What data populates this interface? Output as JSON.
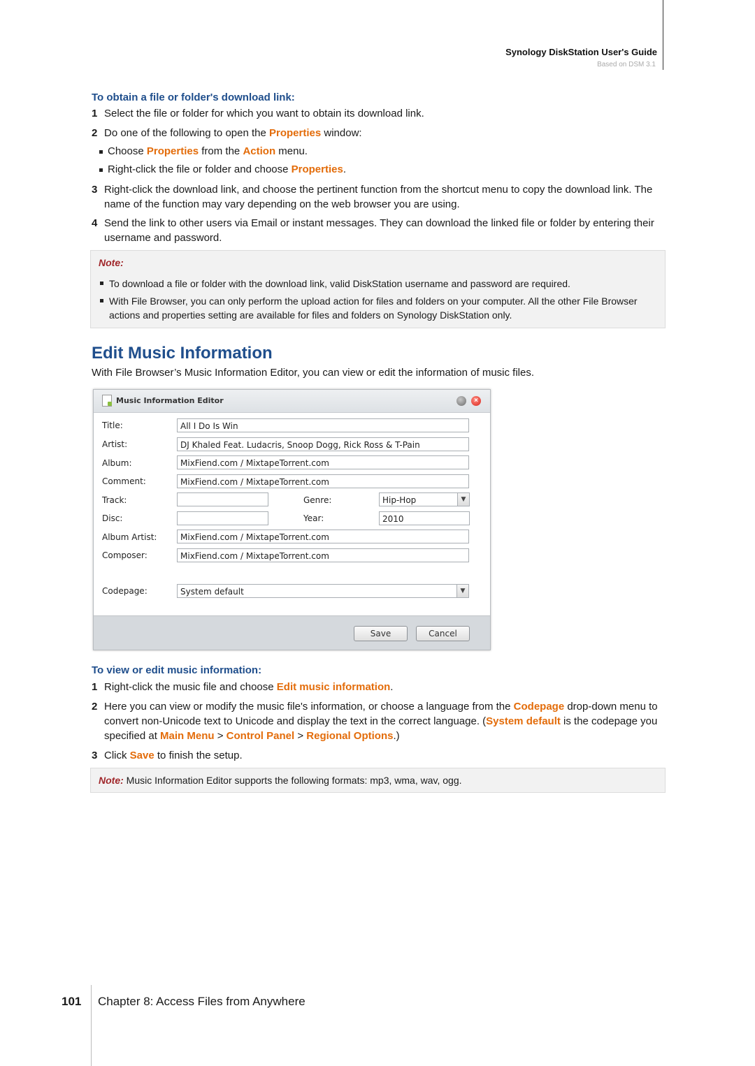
{
  "header": {
    "title": "Synology DiskStation User's Guide",
    "subtitle": "Based on DSM 3.1"
  },
  "download_section": {
    "heading": "To obtain a file or folder's download link:",
    "steps": [
      {
        "num": "1",
        "text": "Select the file or folder for which you want to obtain its download link."
      },
      {
        "num": "2",
        "pre": "Do one of the following to open the ",
        "em": "Properties",
        "post": " window:"
      },
      {
        "num": "3",
        "text": "Right-click the download link, and choose the pertinent function from the shortcut menu to copy the download link. The name of the function may vary depending on the web browser you are using."
      },
      {
        "num": "4",
        "text": "Send the link to other users via Email or instant messages. They can download the linked file or folder by entering their username and password."
      }
    ],
    "sub_bullets": [
      {
        "pre": "Choose ",
        "em1": "Properties",
        "mid": " from the ",
        "em2": "Action",
        "post": " menu."
      },
      {
        "pre": "Right-click the file or folder and choose ",
        "em1": "Properties",
        "post": "."
      }
    ],
    "note": {
      "label": "Note:",
      "items": [
        "To download a file or folder with the download link, valid DiskStation username and password are required.",
        "With File Browser, you can only perform the upload action for files and folders on your computer. All the other File Browser actions and properties setting are available for files and folders on Synology DiskStation only."
      ]
    }
  },
  "edit_music": {
    "heading": "Edit Music Information",
    "intro": "With File Browser’s Music Information Editor, you can view or edit the information of music files."
  },
  "dialog": {
    "title": "Music Information Editor",
    "fields": {
      "title": {
        "label": "Title:",
        "value": "All I Do Is Win"
      },
      "artist": {
        "label": "Artist:",
        "value": "DJ Khaled Feat. Ludacris, Snoop Dogg, Rick Ross & T-Pain"
      },
      "album": {
        "label": "Album:",
        "value": "MixFiend.com / MixtapeTorrent.com"
      },
      "comment": {
        "label": "Comment:",
        "value": "MixFiend.com / MixtapeTorrent.com"
      },
      "track": {
        "label": "Track:",
        "value": ""
      },
      "genre": {
        "label": "Genre:",
        "value": "Hip-Hop"
      },
      "disc": {
        "label": "Disc:",
        "value": ""
      },
      "year": {
        "label": "Year:",
        "value": "2010"
      },
      "album_artist": {
        "label": "Album Artist:",
        "value": "MixFiend.com / MixtapeTorrent.com"
      },
      "composer": {
        "label": "Composer:",
        "value": "MixFiend.com / MixtapeTorrent.com"
      },
      "codepage": {
        "label": "Codepage:",
        "value": "System default"
      }
    },
    "buttons": {
      "save": "Save",
      "cancel": "Cancel"
    }
  },
  "view_section": {
    "heading": "To view or edit music information:",
    "step1": {
      "num": "1",
      "pre": "Right-click the music file and choose ",
      "em": "Edit music information",
      "post": "."
    },
    "step2": {
      "num": "2",
      "pre": "Here you can view or modify the music file's information, or choose a language from the ",
      "em1": "Codepage",
      "mid1": " drop-down menu to convert non-Unicode text to Unicode and display the text in the correct language. (",
      "em2": "System default",
      "mid2": " is the codepage you specified at ",
      "em3": "Main Menu",
      "sep1": " > ",
      "em4": "Control Panel",
      "sep2": " > ",
      "em5": "Regional Options",
      "post": ".)"
    },
    "step3": {
      "num": "3",
      "pre": "Click ",
      "em": "Save",
      "post": " to finish the setup."
    },
    "note": {
      "label": "Note:",
      "text": " Music Information Editor supports the following formats: mp3, wma, wav, ogg."
    }
  },
  "footer": {
    "page_number": "101",
    "chapter": "Chapter 8: Access Files from Anywhere"
  }
}
